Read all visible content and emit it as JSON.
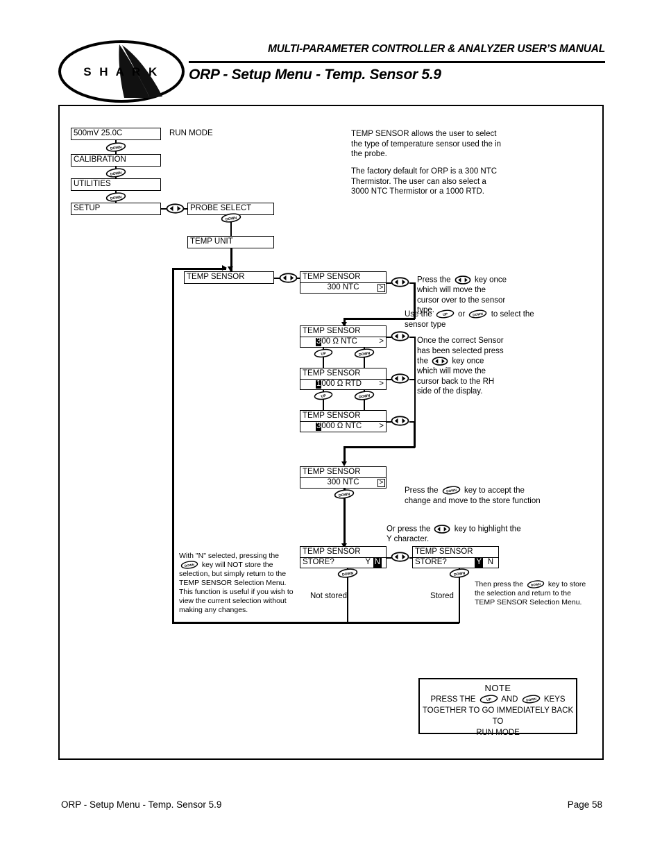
{
  "header": {
    "manual_title": "MULTI-PARAMETER CONTROLLER & ANALYZER USER’S MANUAL",
    "page_heading": "ORP - Setup Menu - Temp. Sensor 5.9",
    "logo_text": "S H A R K"
  },
  "footer": {
    "left": "ORP - Setup Menu - Temp. Sensor 5.9",
    "right": "Page 58"
  },
  "menu_chain": {
    "run_mode_display": "500mV   25.0C",
    "run_mode_label": "RUN MODE",
    "calibration": "CALIBRATION",
    "utilities": "UTILITIES",
    "setup": "SETUP",
    "probe_select": "PROBE SELECT",
    "temp_unit": "TEMP UNIT",
    "temp_sensor": "TEMP SENSOR"
  },
  "intro": {
    "paragraph1": "TEMP SENSOR allows the user to select the type of temperature sensor used the in the probe.",
    "paragraph2": "The factory default for ORP is a 300 NTC Thermistor. The user can also select a 3000 NTC Thermistor or a 1000 RTD."
  },
  "screens": {
    "title": "TEMP SENSOR",
    "value_300ntc": "300   NTC",
    "opt1_cursor": "3",
    "opt1_rest": "00 Ω NTC",
    "opt2_cursor": "1",
    "opt2_rest": "000 Ω RTD",
    "opt3_cursor": "3",
    "opt3_rest": "000 Ω NTC",
    "store_label": "STORE?",
    "store_yes": "Y",
    "store_no": "N",
    "gt_glyph": ">"
  },
  "instructions": {
    "press_lr_once": {
      "before": "Press the",
      "after": "key once which will move the cursor over to the sensor type."
    },
    "use_up_down": {
      "before": "Use the",
      "middle": "or",
      "after": "to select the sensor type"
    },
    "once_correct": {
      "before": "Once the correct Sensor has been selected press the",
      "after": "key once which will move the cursor back to the RH side of the display."
    },
    "press_down_accept": {
      "before": "Press the",
      "after": "key to accept the change and move to the store function"
    },
    "or_press_lr": {
      "before": "Or press the",
      "after": "key to highlight the Y character."
    },
    "with_n_selected": {
      "before": "With \"N\" selected, pressing the",
      "after": "key will NOT store the selection, but simply return to the TEMP SENSOR Selection Menu. This function is useful if you wish to view the current selection without making any changes."
    },
    "then_press_down": {
      "before": "Then press the",
      "after": "key to store the selection and return to the TEMP SENSOR Selection Menu."
    },
    "not_stored": "Not stored",
    "stored": "Stored"
  },
  "note": {
    "title": "NOTE",
    "line1_before": "PRESS THE",
    "line1_middle": "AND",
    "line1_after": "KEYS",
    "line2": "TOGETHER TO GO IMMEDIATELY BACK TO",
    "line3": "RUN MODE"
  },
  "keys": {
    "up": "UP",
    "down": "DOWN",
    "left_right": "◄ ►"
  },
  "colors": {
    "ink": "#000000",
    "paper": "#ffffff"
  }
}
